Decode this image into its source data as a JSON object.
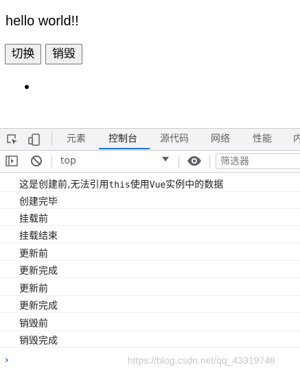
{
  "page": {
    "heading": "hello world!!",
    "buttons": {
      "switch_label": "切换",
      "destroy_label": "销毁"
    }
  },
  "devtools": {
    "tabs": [
      {
        "label": "元素"
      },
      {
        "label": "控制台",
        "active": true
      },
      {
        "label": "源代码"
      },
      {
        "label": "网络"
      },
      {
        "label": "性能"
      },
      {
        "label": "内"
      }
    ],
    "toolbar": {
      "context": "top",
      "filter_placeholder": "筛选器"
    },
    "console": {
      "first_log": {
        "pre": "这是创建前,无法引用",
        "code1": "this",
        "mid": "使用",
        "code2": "Vue",
        "post": "实例中的数据"
      },
      "logs": [
        "创建完毕",
        "挂载前",
        "挂载结束",
        "更新前",
        "更新完成",
        "更新前",
        "更新完成",
        "销毁前",
        "销毁完成"
      ],
      "prompt": "›"
    }
  },
  "watermark": "https://blog.csdn.net/qq_43319748",
  "colors": {
    "accent": "#1a73e8",
    "panel_bg": "#f1f3f4",
    "border": "#cacdd1"
  },
  "icons": [
    "inspect-element-icon",
    "device-toolbar-icon",
    "sidebar-toggle-icon",
    "clear-console-icon",
    "live-expression-eye-icon",
    "dropdown-arrow-icon",
    "prompt-chevron-icon"
  ]
}
